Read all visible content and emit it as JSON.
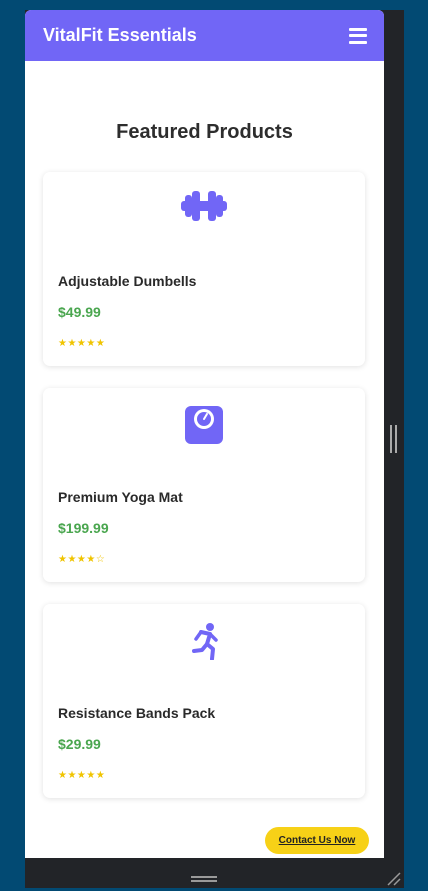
{
  "header": {
    "brand": "VitalFit Essentials",
    "menu_icon": "hamburger-menu-icon"
  },
  "section": {
    "title": "Featured Products"
  },
  "products": [
    {
      "name": "Adjustable Dumbells",
      "price": "$49.99",
      "rating": "★★★★★",
      "icon": "dumbbell-icon"
    },
    {
      "name": "Premium Yoga Mat",
      "price": "$199.99",
      "rating": "★★★★☆",
      "icon": "scale-icon"
    },
    {
      "name": "Resistance Bands Pack",
      "price": "$29.99",
      "rating": "★★★★★",
      "icon": "running-person-icon"
    }
  ],
  "contact": {
    "label": "Contact Us Now"
  },
  "colors": {
    "accent": "#7166f6",
    "price": "#4aa64f",
    "star": "#f0c400",
    "cta": "#f7d117",
    "background": "#024a73"
  }
}
